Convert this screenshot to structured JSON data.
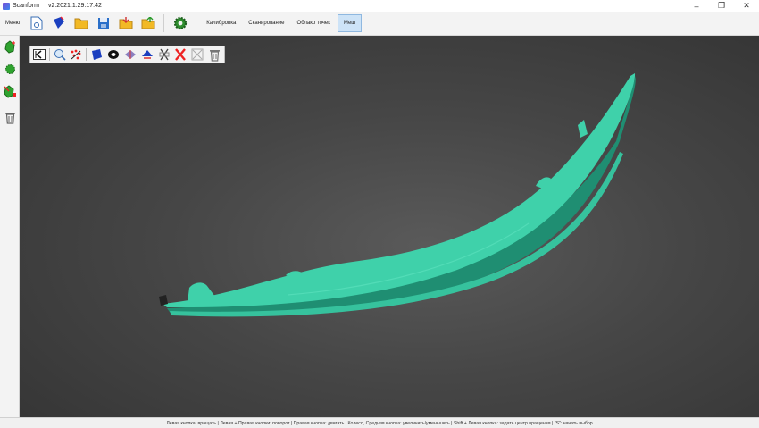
{
  "window": {
    "app_name": "Scanform",
    "version": "v2.2021.1.29.17.42",
    "controls": {
      "minimize": "–",
      "maximize": "❐",
      "close": "✕"
    }
  },
  "toolbar": {
    "menu_label": "Меню",
    "icons": [
      "new-project-icon",
      "scanner-icon",
      "open-folder-icon",
      "save-icon",
      "import-icon",
      "export-icon",
      "settings-gear-icon"
    ],
    "tabs": [
      {
        "label": "Калибровка",
        "active": false
      },
      {
        "label": "Сканирование",
        "active": false
      },
      {
        "label": "Облако точек",
        "active": false
      },
      {
        "label": "Меш",
        "active": true
      }
    ]
  },
  "left_tools": [
    "add-mesh-icon",
    "green-blob-icon",
    "remove-mesh-icon",
    "trash-icon"
  ],
  "mesh_toolbar": {
    "icons": [
      "fit-view-icon",
      "zoom-icon",
      "select-noise-icon",
      "fill-holes-icon",
      "ring-icon",
      "smooth-icon",
      "simplify-icon",
      "cut-icon",
      "delete-selection-icon",
      "invert-selection-icon",
      "trash-icon"
    ]
  },
  "colors": {
    "mesh": "#3fd1aa",
    "mesh_shadow": "#1f8e72",
    "viewport_bg": "#4a4a4a",
    "active_tab": "#cde3f7"
  },
  "status_bar": {
    "text": "Левая кнопка: вращать  |  Левая + Правая кнопки: поворот  |  Правая кнопка: двигать  |  Колесо, Средняя кнопка: увеличить/уменьшить  |  Shift + Левая кнопка: задать центр вращения  |  \"S\": начать выбор"
  }
}
